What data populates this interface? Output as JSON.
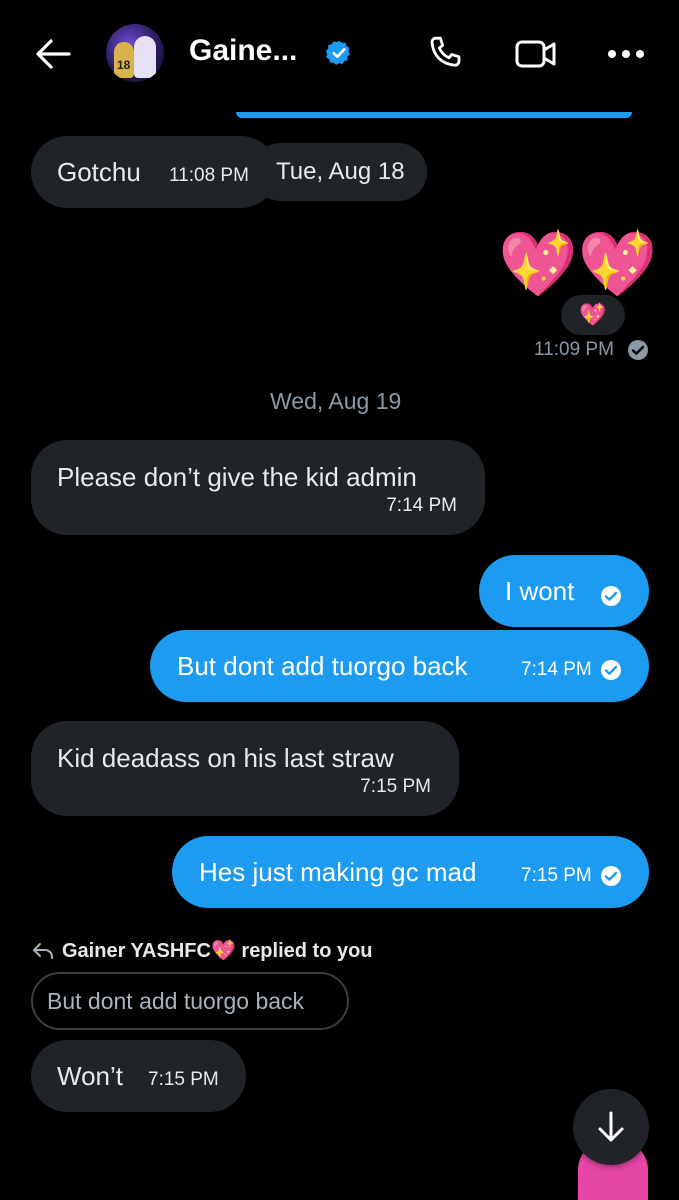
{
  "header": {
    "title": "Gaine...",
    "back_icon": "arrow-left-icon",
    "call_icon": "phone-icon",
    "video_icon": "video-camera-icon",
    "more_icon": "more-horizontal-icon",
    "verified_icon": "verified-badge-icon",
    "accent": "#1d9bf0",
    "avatar_jersey": "18"
  },
  "messages": {
    "m1": {
      "text": "Gotchu",
      "time": "11:08 PM"
    },
    "date1": "Tue, Aug 18",
    "m2": {
      "emoji": "💖💖",
      "reaction": "💖",
      "time": "11:09 PM"
    },
    "date2": "Wed, Aug 19",
    "m3": {
      "text": "Please don’t give the kid admin",
      "time": "7:14 PM"
    },
    "m4": {
      "text": "I wont"
    },
    "m5": {
      "text": "But dont add tuorgo back",
      "time": "7:14 PM"
    },
    "m6": {
      "text": "Kid deadass on his last straw",
      "time": "7:15 PM"
    },
    "m7": {
      "text": "Hes just making gc mad",
      "time": "7:15 PM"
    },
    "reply_context": "Gainer YASHFC💖 replied to you",
    "quoted": "But dont add tuorgo back",
    "m8": {
      "text": "Won’t",
      "time": "7:15 PM"
    }
  },
  "colors": {
    "sent_bubble": "#1d9bf0",
    "received_bubble": "#202327",
    "background": "#000000"
  },
  "scroll_button_icon": "arrow-down-icon"
}
